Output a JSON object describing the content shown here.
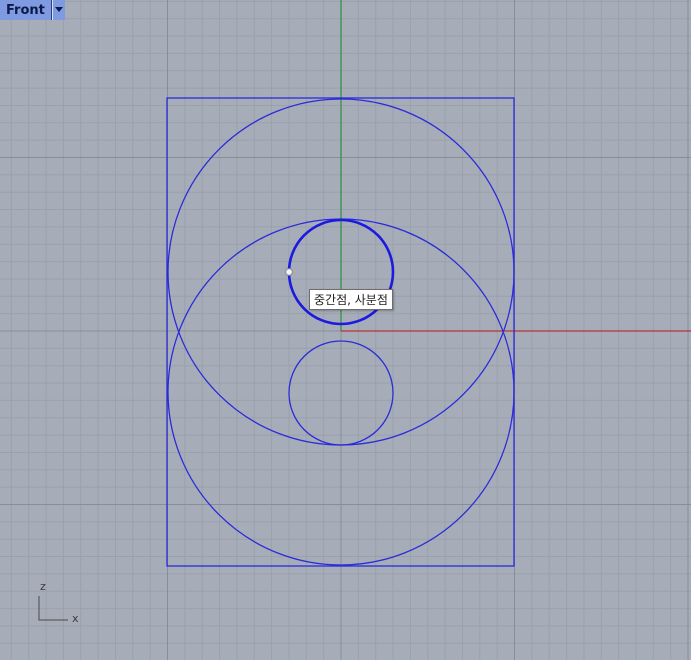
{
  "viewport": {
    "name": "Front",
    "dropdown_icon": "chevron-down-icon"
  },
  "snap_tooltip": "중간점, 사분점",
  "axis_indicator": {
    "vertical": "z",
    "horizontal": "x"
  },
  "colors": {
    "background": "#a6adb8",
    "grid_minor": "#9aa1ad",
    "grid_major": "#878e9a",
    "curves": "#2b2bd9",
    "selected_curve": "#1a1ae0",
    "x_axis": "#b8323a",
    "y_axis": "#2f8f3a",
    "tab": "#7f9ae0"
  }
}
